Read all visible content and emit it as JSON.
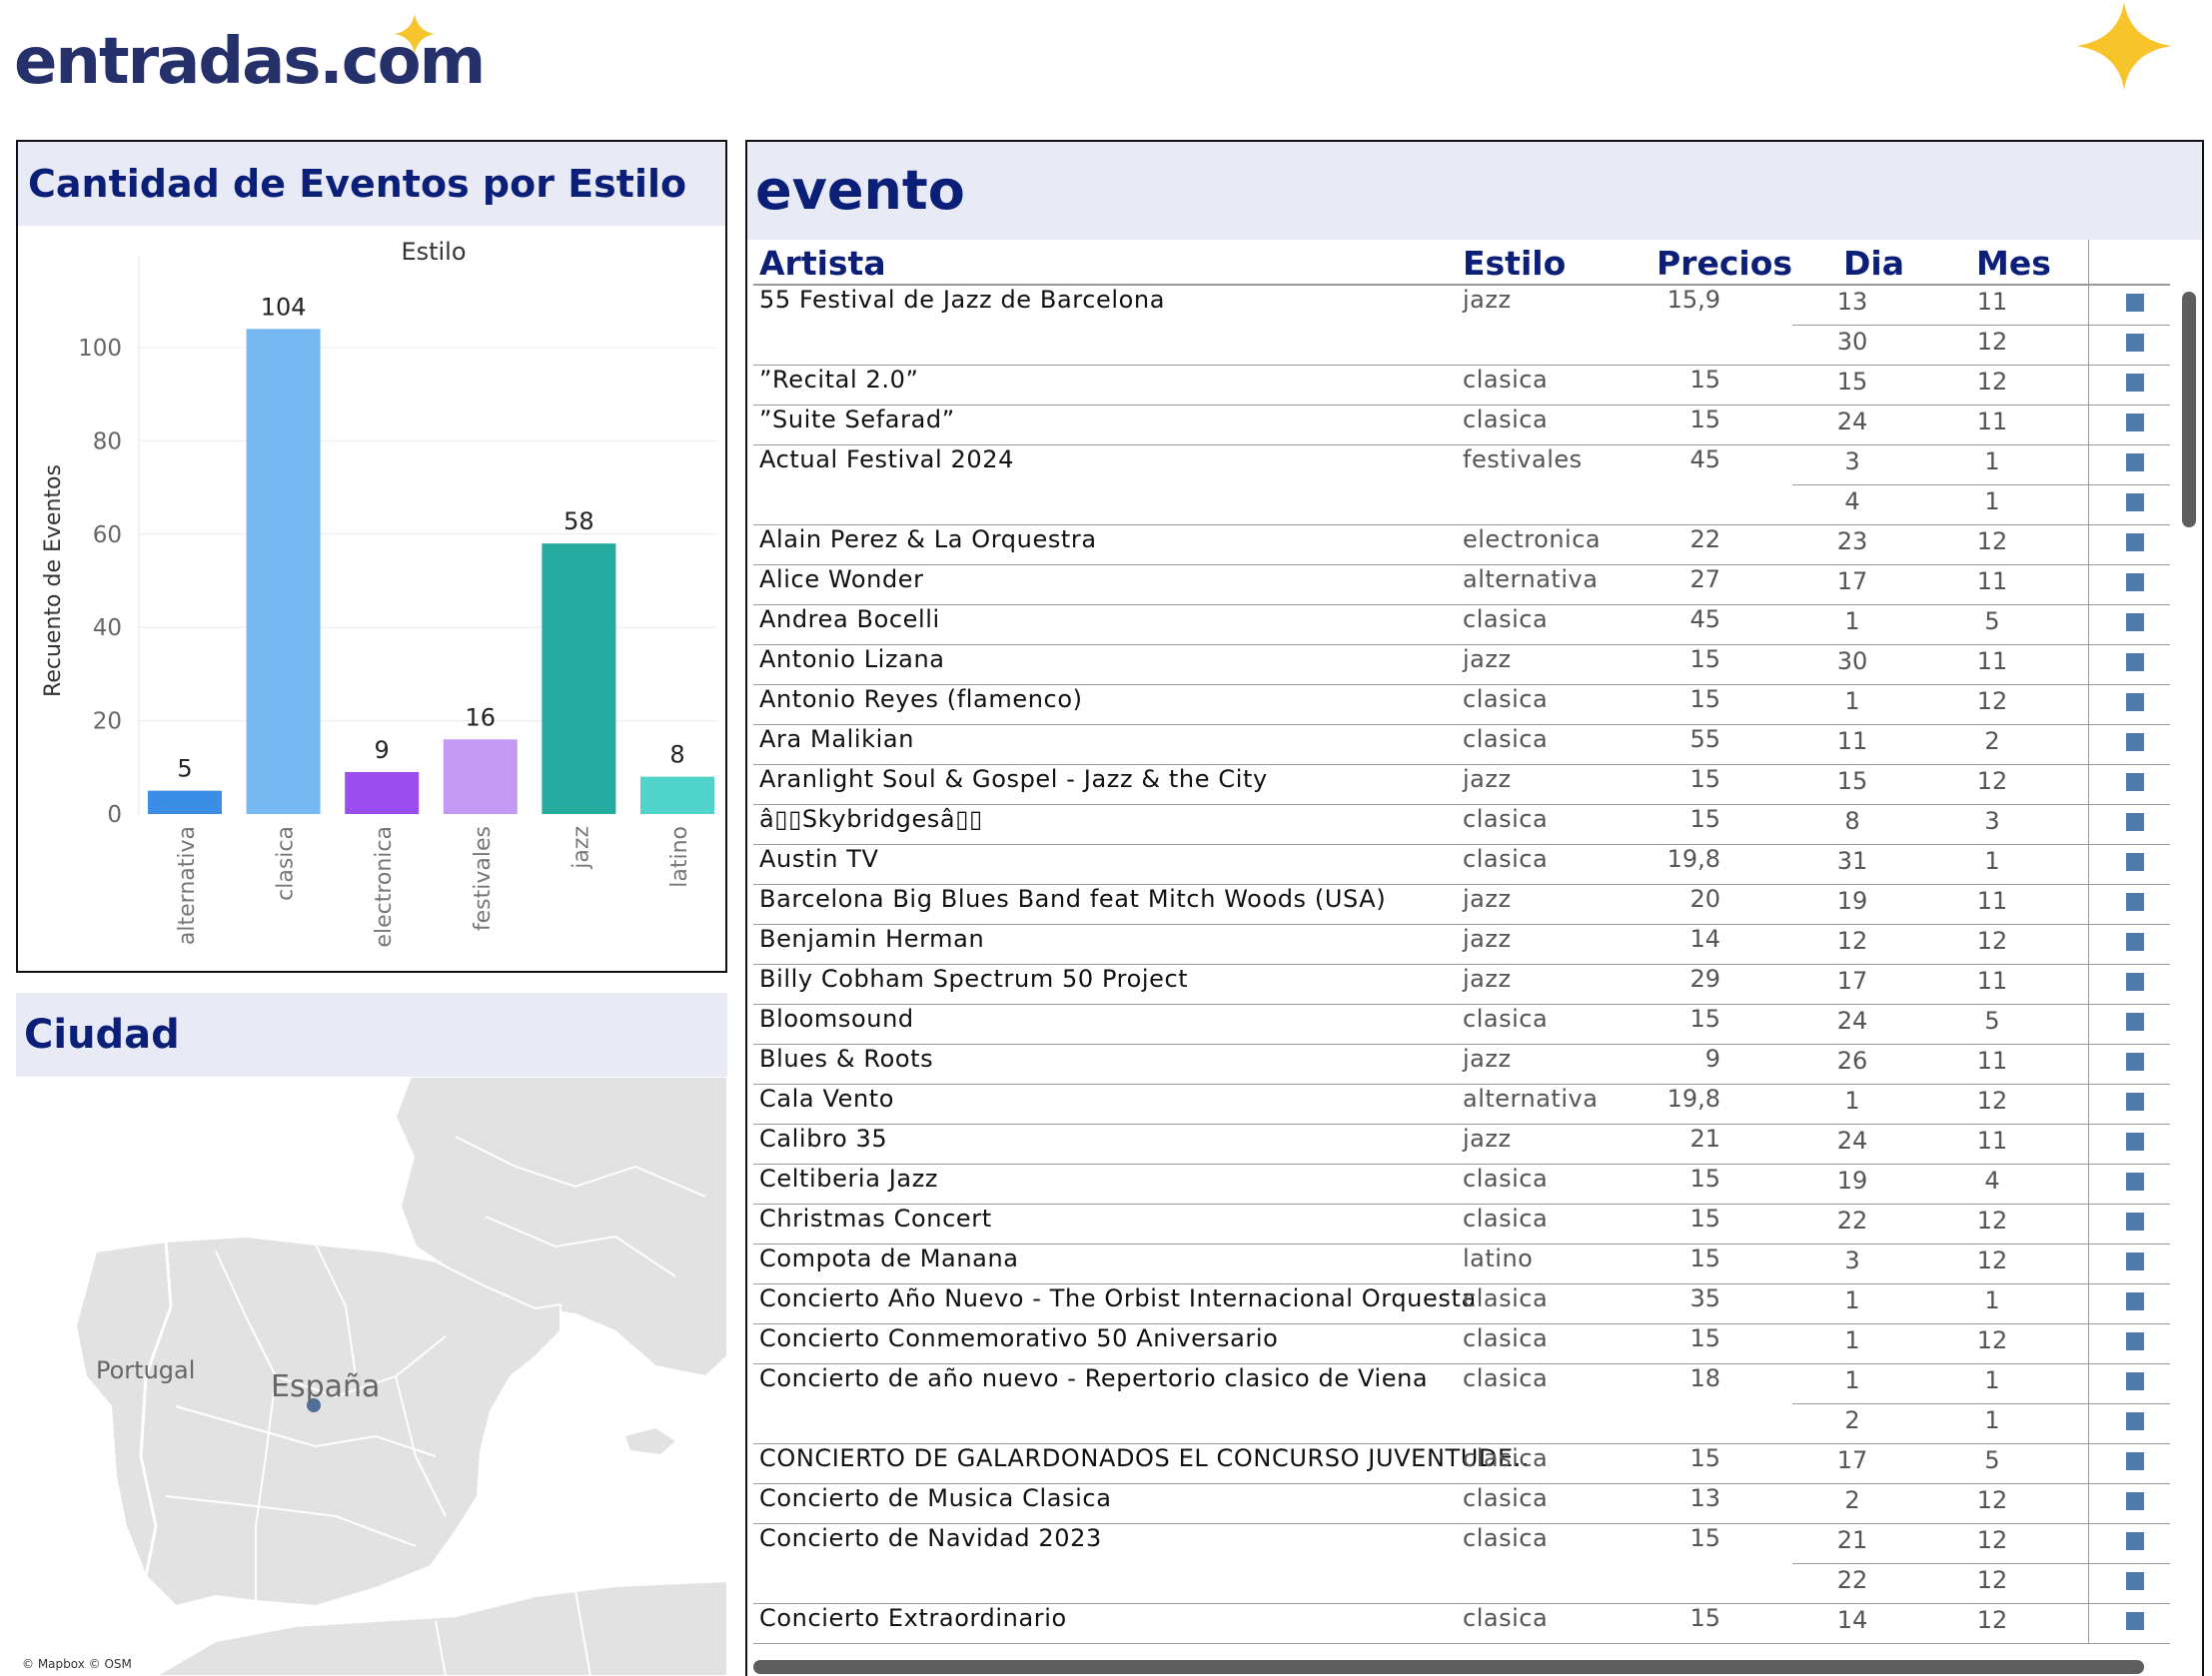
{
  "brand": {
    "logo_text": "entradas.com",
    "star_color": "#f7c52b",
    "brand_color": "#26306b"
  },
  "chart_panel": {
    "title": "Cantidad de Eventos por Estilo"
  },
  "chart_data": {
    "type": "bar",
    "title": "Estilo",
    "xlabel": "",
    "ylabel": "Recuento de Eventos",
    "categories": [
      "alternativa",
      "clasica",
      "electronica",
      "festivales",
      "jazz",
      "latino"
    ],
    "values": [
      5,
      104,
      9,
      16,
      58,
      8
    ],
    "colors": [
      "#3a8ee6",
      "#75b8f2",
      "#9b4ef0",
      "#c29af3",
      "#25aaa0",
      "#4fd3cb"
    ],
    "ylim": [
      0,
      114
    ],
    "yticks": [
      0,
      20,
      40,
      60,
      80,
      100
    ],
    "grid": true,
    "legend": "none"
  },
  "map_panel": {
    "title": "Ciudad",
    "label_portugal": "Portugal",
    "label_espana": "España",
    "attribution": "© Mapbox © OSM"
  },
  "table_panel": {
    "title": "evento",
    "columns": {
      "artista": "Artista",
      "estilo": "Estilo",
      "precios": "Precios",
      "dia": "Dia",
      "mes": "Mes"
    },
    "rows": [
      {
        "artista": "55 Festival de Jazz de Barcelona",
        "estilo": "jazz",
        "precios": "15,9",
        "dates": [
          [
            "13",
            "11"
          ],
          [
            "30",
            "12"
          ]
        ]
      },
      {
        "artista": "”Recital 2.0”",
        "estilo": "clasica",
        "precios": "15",
        "dates": [
          [
            "15",
            "12"
          ]
        ]
      },
      {
        "artista": "”Suite Sefarad”",
        "estilo": "clasica",
        "precios": "15",
        "dates": [
          [
            "24",
            "11"
          ]
        ]
      },
      {
        "artista": "Actual Festival 2024",
        "estilo": "festivales",
        "precios": "45",
        "dates": [
          [
            "3",
            "1"
          ],
          [
            "4",
            "1"
          ]
        ]
      },
      {
        "artista": "Alain Perez & La Orquestra",
        "estilo": "electronica",
        "precios": "22",
        "dates": [
          [
            "23",
            "12"
          ]
        ]
      },
      {
        "artista": "Alice Wonder",
        "estilo": "alternativa",
        "precios": "27",
        "dates": [
          [
            "17",
            "11"
          ]
        ]
      },
      {
        "artista": "Andrea Bocelli",
        "estilo": "clasica",
        "precios": "45",
        "dates": [
          [
            "1",
            "5"
          ]
        ]
      },
      {
        "artista": "Antonio Lizana",
        "estilo": "jazz",
        "precios": "15",
        "dates": [
          [
            "30",
            "11"
          ]
        ]
      },
      {
        "artista": "Antonio Reyes (flamenco)",
        "estilo": "clasica",
        "precios": "15",
        "dates": [
          [
            "1",
            "12"
          ]
        ]
      },
      {
        "artista": "Ara Malikian",
        "estilo": "clasica",
        "precios": "55",
        "dates": [
          [
            "11",
            "2"
          ]
        ]
      },
      {
        "artista": "Aranlight Soul & Gospel - Jazz & the City",
        "estilo": "jazz",
        "precios": "15",
        "dates": [
          [
            "15",
            "12"
          ]
        ]
      },
      {
        "artista": "â▯▯Skybridgesâ▯▯",
        "estilo": "clasica",
        "precios": "15",
        "dates": [
          [
            "8",
            "3"
          ]
        ]
      },
      {
        "artista": "Austin TV",
        "estilo": "clasica",
        "precios": "19,8",
        "dates": [
          [
            "31",
            "1"
          ]
        ]
      },
      {
        "artista": "Barcelona Big Blues Band feat Mitch Woods (USA)",
        "estilo": "jazz",
        "precios": "20",
        "dates": [
          [
            "19",
            "11"
          ]
        ]
      },
      {
        "artista": "Benjamin Herman",
        "estilo": "jazz",
        "precios": "14",
        "dates": [
          [
            "12",
            "12"
          ]
        ]
      },
      {
        "artista": "Billy Cobham Spectrum 50 Project",
        "estilo": "jazz",
        "precios": "29",
        "dates": [
          [
            "17",
            "11"
          ]
        ]
      },
      {
        "artista": "Bloomsound",
        "estilo": "clasica",
        "precios": "15",
        "dates": [
          [
            "24",
            "5"
          ]
        ]
      },
      {
        "artista": "Blues & Roots",
        "estilo": "jazz",
        "precios": "9",
        "dates": [
          [
            "26",
            "11"
          ]
        ]
      },
      {
        "artista": "Cala Vento",
        "estilo": "alternativa",
        "precios": "19,8",
        "dates": [
          [
            "1",
            "12"
          ]
        ]
      },
      {
        "artista": "Calibro 35",
        "estilo": "jazz",
        "precios": "21",
        "dates": [
          [
            "24",
            "11"
          ]
        ]
      },
      {
        "artista": "Celtiberia Jazz",
        "estilo": "clasica",
        "precios": "15",
        "dates": [
          [
            "19",
            "4"
          ]
        ]
      },
      {
        "artista": "Christmas Concert",
        "estilo": "clasica",
        "precios": "15",
        "dates": [
          [
            "22",
            "12"
          ]
        ]
      },
      {
        "artista": "Compota de Manana",
        "estilo": "latino",
        "precios": "15",
        "dates": [
          [
            "3",
            "12"
          ]
        ]
      },
      {
        "artista": "Concierto Año Nuevo - The Orbist Internacional Orquesta",
        "estilo": "clasica",
        "precios": "35",
        "dates": [
          [
            "1",
            "1"
          ]
        ]
      },
      {
        "artista": "Concierto Conmemorativo 50 Aniversario",
        "estilo": "clasica",
        "precios": "15",
        "dates": [
          [
            "1",
            "12"
          ]
        ]
      },
      {
        "artista": "Concierto de año nuevo - Repertorio clasico de Viena",
        "estilo": "clasica",
        "precios": "18",
        "dates": [
          [
            "1",
            "1"
          ],
          [
            "2",
            "1"
          ]
        ]
      },
      {
        "artista": "CONCIERTO DE GALARDONADOS EL CONCURSO JUVENTUDE..",
        "estilo": "clasica",
        "precios": "15",
        "dates": [
          [
            "17",
            "5"
          ]
        ]
      },
      {
        "artista": "Concierto de Musica Clasica",
        "estilo": "clasica",
        "precios": "13",
        "dates": [
          [
            "2",
            "12"
          ]
        ]
      },
      {
        "artista": "Concierto de Navidad 2023",
        "estilo": "clasica",
        "precios": "15",
        "dates": [
          [
            "21",
            "12"
          ],
          [
            "22",
            "12"
          ]
        ]
      },
      {
        "artista": "Concierto Extraordinario",
        "estilo": "clasica",
        "precios": "15",
        "dates": [
          [
            "14",
            "12"
          ]
        ]
      }
    ]
  }
}
